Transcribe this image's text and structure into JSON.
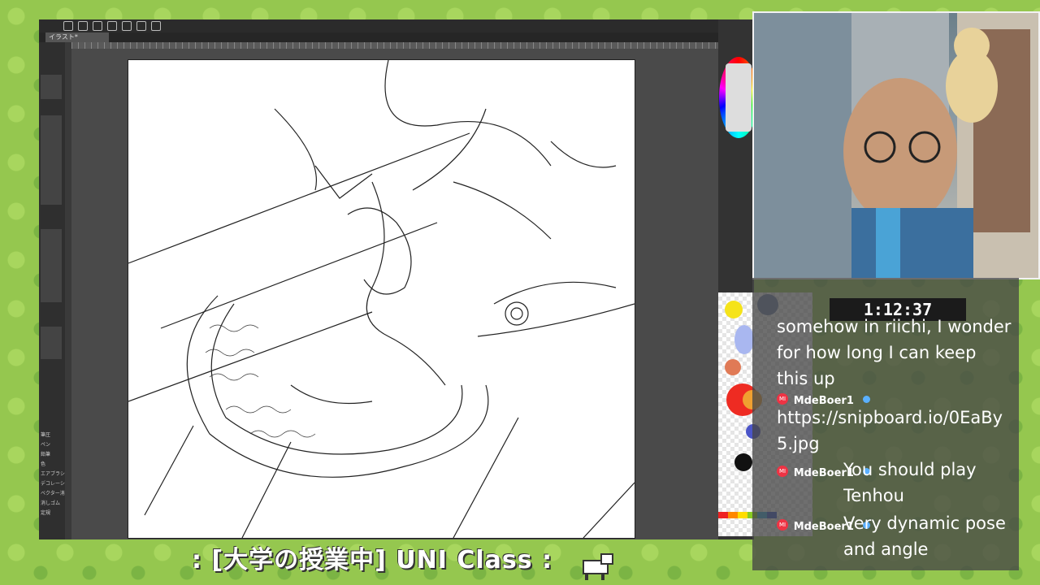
{
  "app": {
    "doc_tab": "イラスト*",
    "left_menu": [
      "筆圧",
      "ペン",
      "鉛筆",
      "色",
      "エアブラシ",
      "デコレーション",
      "ベクター消去",
      "消しゴム",
      "定規"
    ]
  },
  "stream": {
    "timer": "1:12:37",
    "chat": {
      "carry_over": "somehow in riichi, I wonder for how long I can keep this up",
      "messages": [
        {
          "user": "MdeBoer1",
          "badge": "MI",
          "text": "https://snipboard.io/0EaBy5.jpg"
        },
        {
          "user": "MdeBoer1",
          "badge": "MI",
          "text": "You should play Tenhou"
        },
        {
          "user": "MdeBoer1",
          "badge": "MI",
          "text": "Very dynamic pose and angle"
        }
      ]
    },
    "caption": ":  [大学の授業中]   UNI Class  :"
  },
  "icons": {
    "toolbar": [
      "new-file-icon",
      "open-icon",
      "save-icon",
      "undo-icon",
      "redo-icon",
      "transform-icon",
      "ruler-icon"
    ]
  }
}
